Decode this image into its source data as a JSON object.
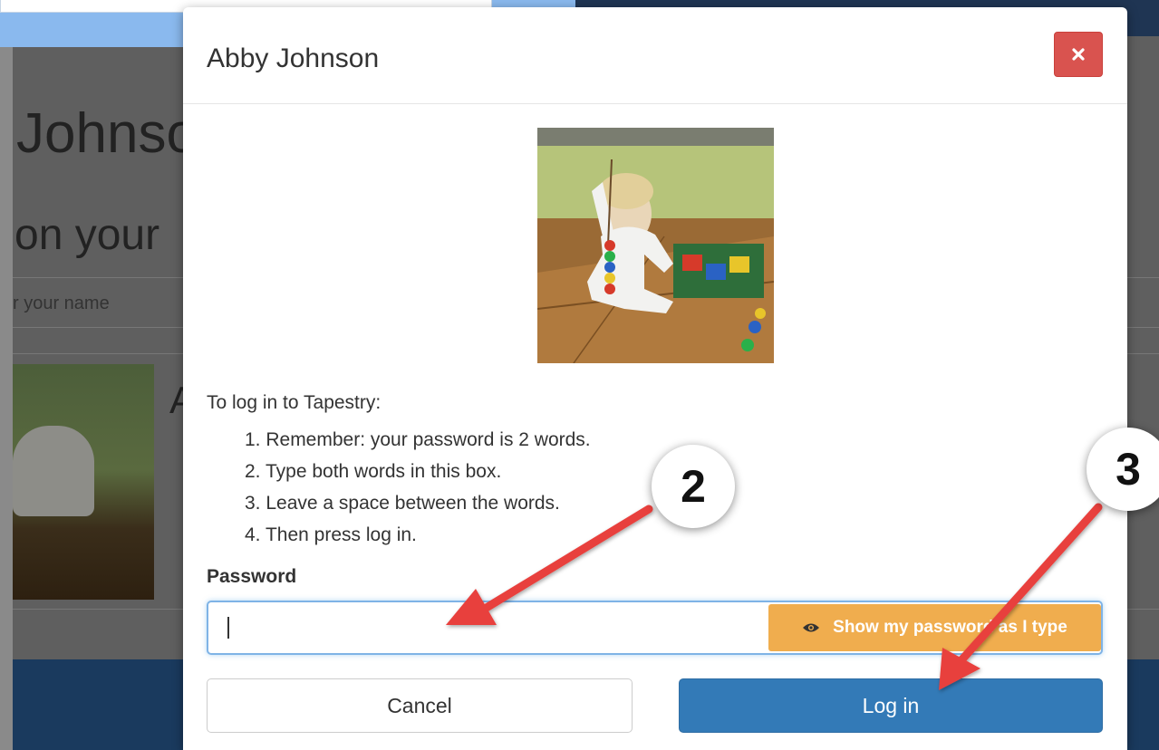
{
  "background": {
    "heading_fragment": "Johnso",
    "sub_fragment": "on your",
    "input_fragment": "r your name",
    "letter_fragment": "A"
  },
  "modal": {
    "title": "Abby Johnson",
    "close_icon": "close-icon",
    "intro": "To log in to Tapestry:",
    "steps": [
      "1. Remember: your password is 2 words.",
      "2. Type both words in this box.",
      "3. Leave a space between the words.",
      "4. Then press log in."
    ],
    "password_label": "Password",
    "password_value": "",
    "show_password_label": "Show my password as I type",
    "show_password_icon": "eye-icon",
    "cancel_label": "Cancel",
    "login_label": "Log in"
  },
  "annotations": {
    "badge_2": "2",
    "badge_3": "3",
    "arrow_color": "#e8413d"
  },
  "colors": {
    "close": "#d9534f",
    "show_password": "#f0ad4e",
    "login": "#337ab7",
    "input_focus": "#7fb3e6"
  }
}
